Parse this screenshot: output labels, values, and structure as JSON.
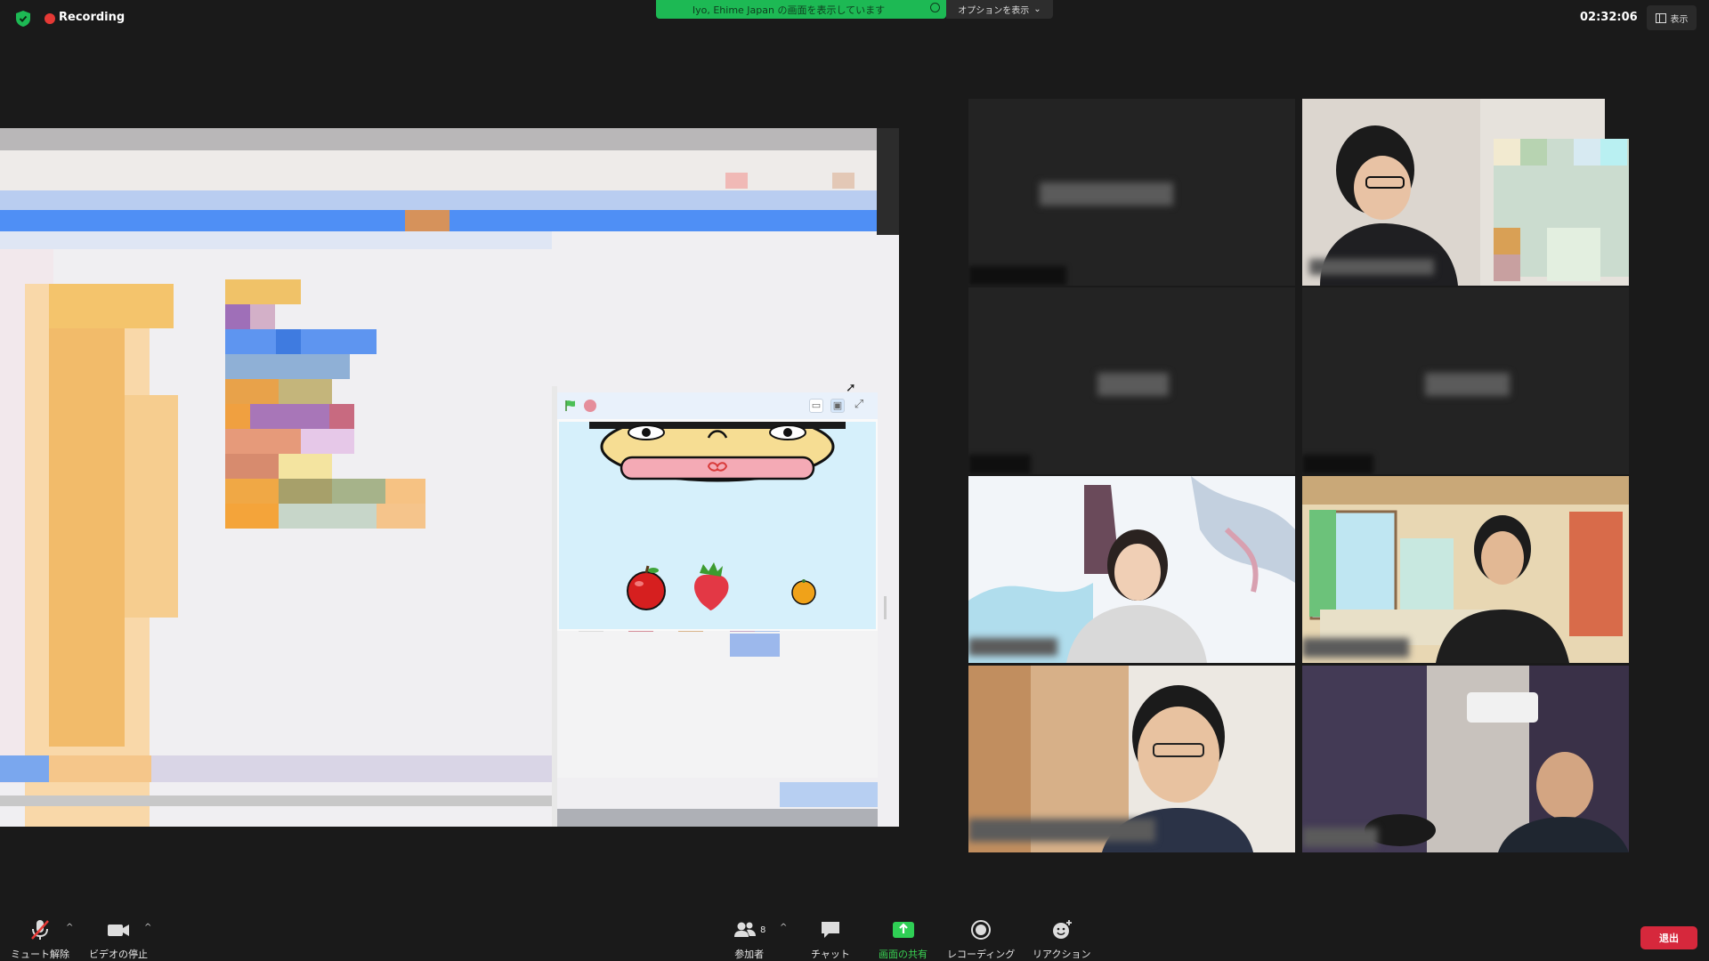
{
  "topbar": {
    "recording_label": "Recording",
    "share_banner_text": "Iyo, Ehime Japan の画面を表示しています",
    "options_label": "オプションを表示",
    "clock": "02:32:06",
    "view_label": "表示"
  },
  "colors": {
    "recording": "#e53935",
    "share_banner": "#1db954",
    "leave": "#d6283c",
    "active_speaker": "#c9de5b"
  },
  "shared_screen": {
    "stage_toolbar": [
      "green-flag-icon",
      "stop-icon",
      "small-stage-icon",
      "normal-stage-icon",
      "fullscreen-icon"
    ],
    "sprites": [
      "face",
      "apple",
      "strawberry",
      "orange"
    ]
  },
  "gallery": {
    "tile_count": 8,
    "active_speaker_tile": 6
  },
  "toolbar": {
    "mute_label": "ミュート解除",
    "video_label": "ビデオの停止",
    "participants_count": "8",
    "participants_label": "参加者",
    "chat_label": "チャット",
    "share_label": "画面の共有",
    "record_label": "レコーディング",
    "reaction_label": "リアクション",
    "leave_label": "退出"
  }
}
